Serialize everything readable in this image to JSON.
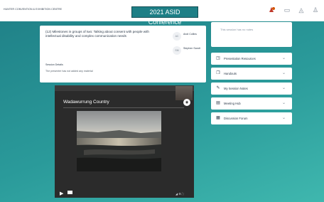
{
  "header": {
    "brand_text": "HUNTER CONVENTION & EXHIBITION CENTRE",
    "title": "2021 ASID Conference",
    "icons": [
      {
        "name": "user-profile-icon",
        "label": "",
        "color": "#c0392b"
      },
      {
        "name": "chat-icon",
        "label": ""
      },
      {
        "name": "notifications-icon",
        "label": ""
      },
      {
        "name": "person-icon",
        "label": ""
      }
    ]
  },
  "session": {
    "title": "(12) Milestones in groups of two: Talking about consent with people with intellectual disability and complex communication needs",
    "meta_lines": [
      "",
      ""
    ],
    "speakers": [
      {
        "avatar": "AC",
        "name": "Andi Collins",
        "role": ""
      },
      {
        "avatar": "SM",
        "name": "Stephen Sandt",
        "role": ""
      }
    ],
    "highlights_heading": "Session Details",
    "highlights_text": "The presenter has not added any material"
  },
  "video": {
    "slide_title": "Wadawurrung Country",
    "controls": {
      "play_icon": "play-icon",
      "right_text": "◢ ⚙ ⛶"
    }
  },
  "sidebar": {
    "panel_text": "This session has no notes",
    "items": [
      {
        "icon": "presentation-icon",
        "glyph": "◳",
        "label": "Presentation Resources"
      },
      {
        "icon": "handouts-icon",
        "glyph": "❐",
        "label": "Handouts"
      },
      {
        "icon": "session-notes-icon",
        "glyph": "✎",
        "label": "My Session Notes"
      },
      {
        "icon": "meeting-hub-icon",
        "glyph": "▤",
        "label": "Meeting Hub"
      },
      {
        "icon": "discussion-forum-icon",
        "glyph": "▦",
        "label": "Discussion Forum"
      }
    ]
  },
  "colors": {
    "accent_teal": "#1e7f86",
    "background_gradient_start": "#1f7f86",
    "background_gradient_end": "#3fb7ae"
  }
}
